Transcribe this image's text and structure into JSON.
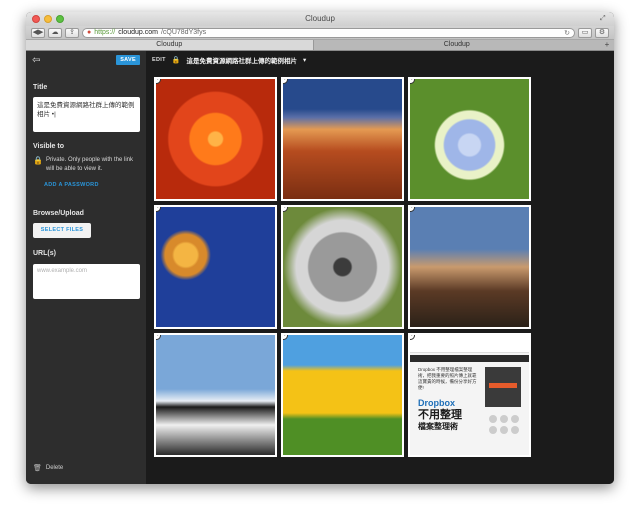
{
  "browser": {
    "window_title": "Cloudup",
    "url_scheme": "https://",
    "url_domain": "cloudup.com",
    "url_path": "/cQU78dY3fys",
    "tabs": [
      {
        "label": "Cloudup",
        "active": true
      },
      {
        "label": "Cloudup",
        "active": false
      }
    ],
    "new_tab": "+"
  },
  "sidebar": {
    "save_label": "SAVE",
    "title_label": "Title",
    "title_value": "這是免費資源網路社群上傳的範例相片 •|",
    "visible_label": "Visible to",
    "visibility_text": "Private. Only people with the link will be able to view it.",
    "add_password": "ADD A PASSWORD",
    "browse_label": "Browse/Upload",
    "select_files": "SELECT FILES",
    "url_label": "URL(s)",
    "url_placeholder": "www.example.com",
    "delete_label": "Delete"
  },
  "main": {
    "edit_label": "EDIT",
    "album_title": "這是免費資源網路社群上傳的範例相片",
    "title_chevron": "▾",
    "tiles": [
      {
        "name": "orange-flower"
      },
      {
        "name": "desert-canyon"
      },
      {
        "name": "hydrangea"
      },
      {
        "name": "jellyfish"
      },
      {
        "name": "koala"
      },
      {
        "name": "lighthouse"
      },
      {
        "name": "penguins"
      },
      {
        "name": "tulips"
      },
      {
        "name": "webpage-screenshot"
      }
    ],
    "doc_text": "Dropbox 不用整理檔案整理術，把我重要的照片傳上就靠這寶貴的時候，備份分享好方便!",
    "doc_big_brand": "Dropbox",
    "doc_big_line1": "不用整理",
    "doc_big_line2": "檔案整理術"
  },
  "colors": {
    "accent": "#2a95d9",
    "sidebar_bg": "#2d2d2d",
    "main_bg": "#1b1b1b"
  }
}
